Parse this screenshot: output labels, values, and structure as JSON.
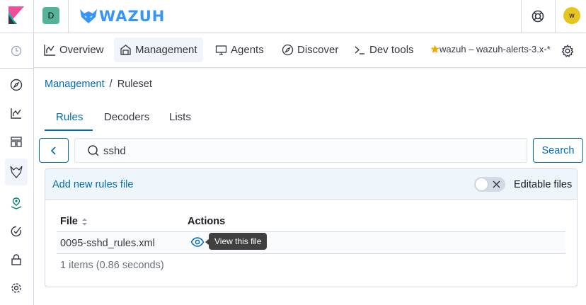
{
  "header": {
    "space_initial": "D",
    "brand": "WAZUH",
    "user_initial": "w"
  },
  "subnav": {
    "tabs": [
      {
        "label": "Overview"
      },
      {
        "label": "Management"
      },
      {
        "label": "Agents"
      },
      {
        "label": "Discover"
      },
      {
        "label": "Dev tools"
      }
    ],
    "index_pattern": "wazuh – wazuh-alerts-3.x-*"
  },
  "breadcrumb": {
    "parent": "Management",
    "separator": "/",
    "current": "Ruleset"
  },
  "ruleset_tabs": [
    {
      "label": "Rules"
    },
    {
      "label": "Decoders"
    },
    {
      "label": "Lists"
    }
  ],
  "search": {
    "value": "sshd",
    "button_label": "Search"
  },
  "panel": {
    "add_link": "Add new rules file",
    "toggle_label": "Editable files",
    "editable_on": false
  },
  "table": {
    "columns": [
      "File",
      "Actions"
    ],
    "rows": [
      {
        "file": "0095-sshd_rules.xml"
      }
    ],
    "tooltip": "View this file",
    "count_text": "1 items (0.86 seconds)"
  },
  "colors": {
    "accent": "#006bb4",
    "brand": "#3595f9",
    "space_avatar": "#54b399",
    "user_avatar": "#e7c520"
  }
}
